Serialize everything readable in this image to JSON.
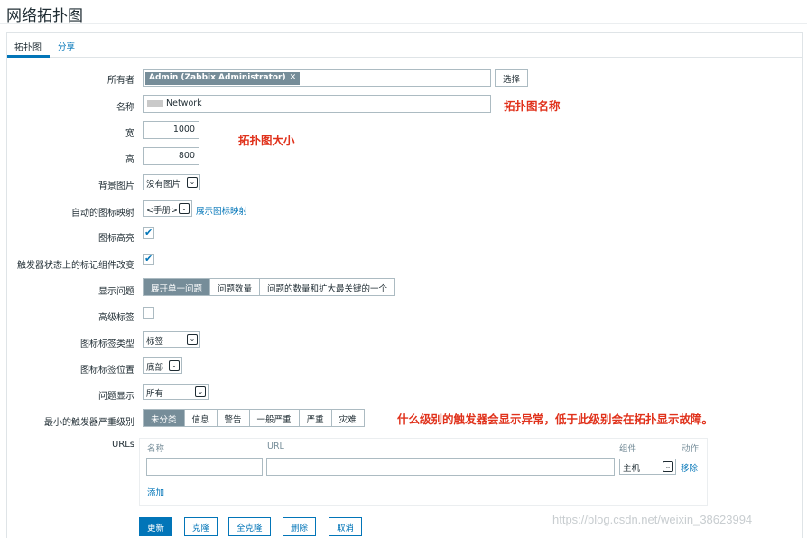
{
  "page": {
    "title": "网络拓扑图"
  },
  "tabs": [
    {
      "label": "拓扑图"
    },
    {
      "label": "分享"
    }
  ],
  "form": {
    "owner": {
      "label": "所有者",
      "tag": "Admin (Zabbix Administrator)",
      "select_button": "选择"
    },
    "name": {
      "label": "名称",
      "value": "Network"
    },
    "width": {
      "label": "宽",
      "value": "1000"
    },
    "height": {
      "label": "高",
      "value": "800"
    },
    "background": {
      "label": "背景图片",
      "value": "没有图片"
    },
    "iconmap": {
      "label": "自动的图标映射",
      "value": "<手册>",
      "link": "展示图标映射"
    },
    "highlight": {
      "label": "图标高亮",
      "checked": true
    },
    "markelements": {
      "label": "触发器状态上的标记组件改变",
      "checked": true
    },
    "problems": {
      "label": "显示问题",
      "options": [
        "展开单一问题",
        "问题数量",
        "问题的数量和扩大最关键的一个"
      ],
      "selected": 0
    },
    "advanced_labels": {
      "label": "高级标签",
      "checked": false
    },
    "label_type": {
      "label": "图标标签类型",
      "value": "标签"
    },
    "label_location": {
      "label": "图标标签位置",
      "value": "底部"
    },
    "problem_display": {
      "label": "问题显示",
      "value": "所有"
    },
    "min_severity": {
      "label": "最小的触发器严重级别",
      "options": [
        "未分类",
        "信息",
        "警告",
        "一般严重",
        "严重",
        "灾难"
      ],
      "selected": 0
    },
    "urls": {
      "label": "URLs",
      "headers": {
        "name": "名称",
        "url": "URL",
        "element": "组件",
        "action": "动作"
      },
      "row": {
        "name": "",
        "url": "",
        "element": "主机",
        "remove": "移除"
      },
      "add": "添加"
    }
  },
  "annotations": {
    "name_note": "拓扑图名称",
    "size_note": "拓扑图大小",
    "severity_note": "什么级别的触发器会显示异常，低于此级别会在拓扑显示故障。"
  },
  "buttons": {
    "update": "更新",
    "clone": "克隆",
    "full_clone": "全克隆",
    "delete": "删除",
    "cancel": "取消"
  },
  "watermark": "https://blog.csdn.net/weixin_38623994",
  "colors": {
    "accent": "#0275b8",
    "annotation": "#e0321c",
    "segment_on": "#768d99"
  }
}
